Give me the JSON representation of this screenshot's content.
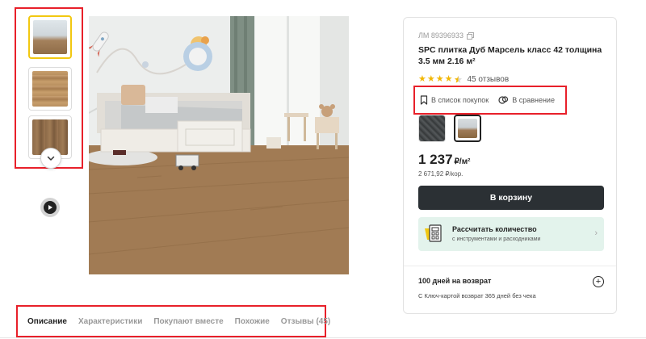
{
  "gallery": {
    "thumbnails": [
      {
        "label": "room",
        "active": true
      },
      {
        "label": "plank-light",
        "active": false
      },
      {
        "label": "plank-dark",
        "active": false
      }
    ],
    "scroll_icon": "chevron-down-icon",
    "video_icon": "play-icon",
    "main_image": "bedroom-with-oak-floor"
  },
  "tabs": [
    {
      "label": "Описание",
      "active": true
    },
    {
      "label": "Характеристики",
      "active": false
    },
    {
      "label": "Покупают вместе",
      "active": false
    },
    {
      "label": "Похожие",
      "active": false
    },
    {
      "label": "Отзывы (45)",
      "active": false
    }
  ],
  "product": {
    "sku": "ЛМ 89396933",
    "title": "SPC плитка Дуб Марсель класс 42 толщина 3.5 мм 2.16 м²",
    "rating": 4.5,
    "reviews": "45 отзывов",
    "actions": {
      "shopping_list": "В список покупок",
      "compare": "В сравнение"
    },
    "price": "1 237",
    "price_unit": "₽/м²",
    "price_box": "2 671,92 ₽/кор.",
    "cart_button": "В корзину",
    "calculator": {
      "title": "Рассчитать количество",
      "subtitle": "с инструментами и расходниками"
    },
    "return_policy": {
      "title": "100 дней на возврат",
      "subtitle": "С Ключ-картой возврат 365 дней без чека"
    }
  },
  "colors": {
    "highlight": "#e8202a",
    "star": "#f2b705",
    "button_dark": "#2b3034",
    "calc_bg": "#e3f3ec",
    "thumb_active": "#f2c811"
  }
}
